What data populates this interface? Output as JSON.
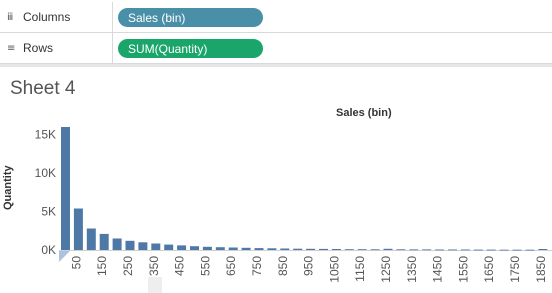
{
  "shelves": {
    "columns": {
      "icon": "columns-icon",
      "glyph": "iii",
      "label": "Columns",
      "pill": "Sales (bin)",
      "pill_color": "#4a8fa8"
    },
    "rows": {
      "icon": "rows-icon",
      "glyph": "≡",
      "label": "Rows",
      "pill": "SUM(Quantity)",
      "pill_color": "#1aa66a"
    }
  },
  "sheet": {
    "title": "Sheet 4"
  },
  "chart_data": {
    "type": "bar",
    "header_title": "Sales (bin)",
    "ylabel": "Quantity",
    "bar_color": "#4e79a7",
    "ylim": [
      0,
      16000
    ],
    "y_ticks": [
      {
        "value": 0,
        "label": "0K"
      },
      {
        "value": 5000,
        "label": "5K"
      },
      {
        "value": 10000,
        "label": "10K"
      },
      {
        "value": 15000,
        "label": "15K"
      }
    ],
    "x_tick_labels": [
      "50",
      "150",
      "250",
      "350",
      "450",
      "550",
      "650",
      "750",
      "850",
      "950",
      "1050",
      "1150",
      "1250",
      "1350",
      "1450",
      "1550",
      "1650",
      "1750",
      "1850"
    ],
    "bins": [
      0,
      50,
      100,
      150,
      200,
      250,
      300,
      350,
      400,
      450,
      500,
      550,
      600,
      650,
      700,
      750,
      800,
      850,
      900,
      950,
      1000,
      1050,
      1100,
      1150,
      1200,
      1250,
      1300,
      1350,
      1400,
      1450,
      1500,
      1550,
      1600,
      1650,
      1700,
      1750,
      1800,
      1850
    ],
    "values": [
      16000,
      5400,
      2800,
      2100,
      1500,
      1200,
      1000,
      850,
      700,
      600,
      500,
      420,
      370,
      320,
      290,
      250,
      220,
      190,
      170,
      150,
      140,
      130,
      110,
      100,
      95,
      150,
      85,
      80,
      75,
      70,
      65,
      60,
      55,
      50,
      40,
      40,
      35,
      130
    ]
  }
}
